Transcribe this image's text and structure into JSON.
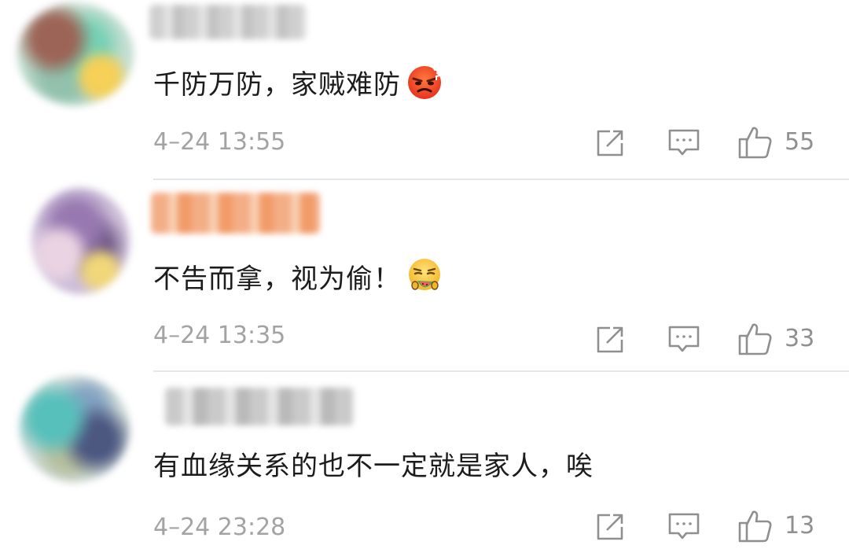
{
  "comments": [
    {
      "text": "千防万防，家贼难防",
      "emoji": "angry-face-emoji",
      "timestamp": "4–24 13:55",
      "likes": "55"
    },
    {
      "text": "不告而拿，视为偷！",
      "emoji": "eating-watermelon-emoji",
      "timestamp": "4–24 13:35",
      "likes": "33"
    },
    {
      "text": "有血缘关系的也不一定就是家人，唉",
      "timestamp": "4–24 23:28",
      "likes": "13"
    }
  ],
  "icons": {
    "share": "share-icon",
    "reply": "reply-icon",
    "like": "thumbs-up-icon"
  },
  "colors": {
    "text": "#1c1c1c",
    "meta": "#a3a3a3",
    "icon": "#8f8f8f",
    "divider": "#e6e6e6"
  }
}
